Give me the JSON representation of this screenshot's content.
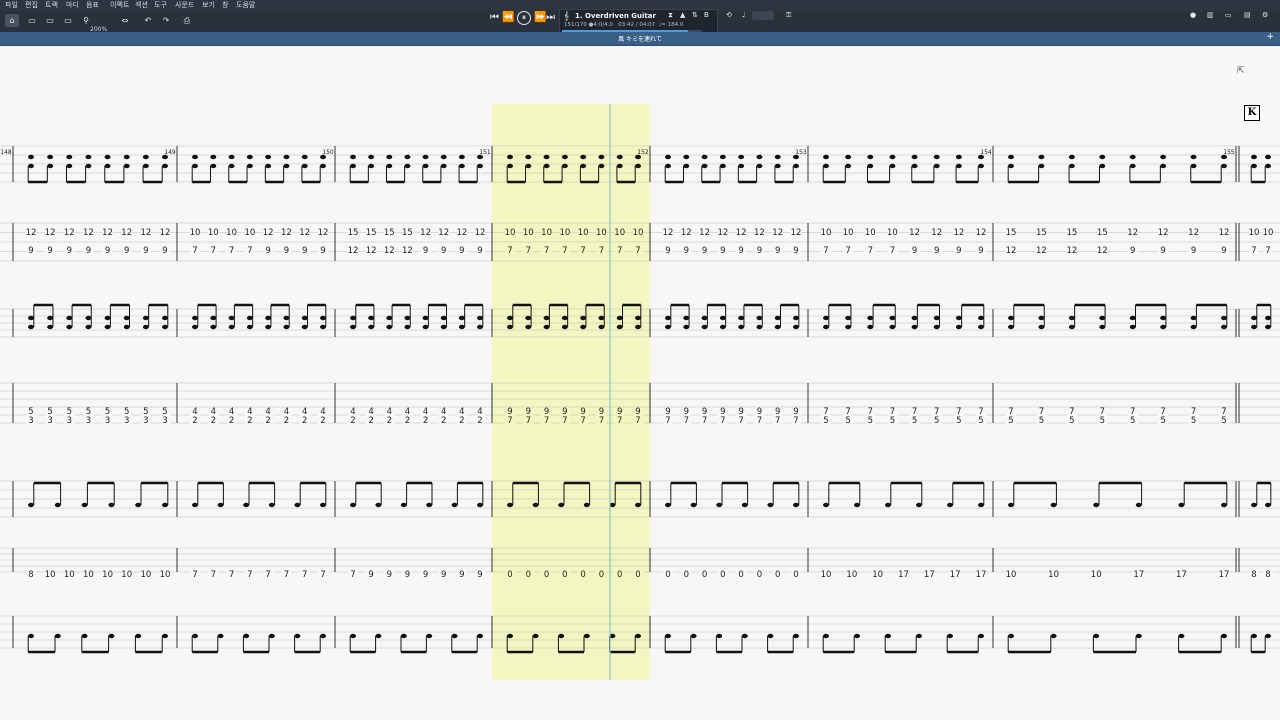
{
  "menu": [
    "파일",
    "편집",
    "트랙",
    "마디",
    "음표",
    "이펙트",
    "섹션",
    "도구",
    "사운드",
    "보기",
    "창",
    "도움말"
  ],
  "toolbar": {
    "zoom": "200%",
    "icons": [
      "home-icon",
      "page-view-icon",
      "screen-icon",
      "horizontal-view-icon",
      "zoom-icon",
      "fit-icon",
      "undo-icon",
      "redo-icon",
      "print-icon"
    ]
  },
  "transport": {
    "buttons": [
      "⏮",
      "⏪",
      "⏸",
      "⏩",
      "⏭"
    ]
  },
  "track": {
    "name": "1. Overdriven Guitar",
    "bar_position": "151/170",
    "time_signature": "4:0/4.0",
    "time": "03:42 / 04:07",
    "tempo": "♩= 184.0",
    "progress": 0.9
  },
  "subtitle": "風 キミを連れて",
  "badge": "K",
  "accent_colors": {
    "highlight": "#f3f6c0",
    "playhead": "#8ec3c0",
    "toolbar": "#2b313b",
    "subbar": "#3a5f86"
  },
  "measures": [
    "148",
    "149",
    "150",
    "151",
    "152",
    "153",
    "154",
    "155"
  ],
  "tab1": {
    "top": [
      [
        "12",
        "12",
        "12",
        "12",
        "12",
        "12",
        "12",
        "12"
      ],
      [
        "10",
        "10",
        "10",
        "10",
        "12",
        "12",
        "12",
        "12"
      ],
      [
        "15",
        "15",
        "15",
        "15",
        "12",
        "12",
        "12",
        "12"
      ],
      [
        "10",
        "10",
        "10",
        "10",
        "10",
        "10",
        "10",
        "10"
      ],
      [
        "12",
        "12",
        "12",
        "12",
        "12",
        "12",
        "12",
        "12"
      ],
      [
        "10",
        "10",
        "10",
        "10",
        "12",
        "12",
        "12",
        "12"
      ],
      [
        "15",
        "15",
        "15",
        "15",
        "12",
        "12",
        "12",
        "12"
      ],
      [
        "10",
        "10"
      ]
    ],
    "bottom": [
      [
        "9",
        "9",
        "9",
        "9",
        "9",
        "9",
        "9",
        "9"
      ],
      [
        "7",
        "7",
        "7",
        "7",
        "9",
        "9",
        "9",
        "9"
      ],
      [
        "12",
        "12",
        "12",
        "12",
        "9",
        "9",
        "9",
        "9"
      ],
      [
        "7",
        "7",
        "7",
        "7",
        "7",
        "7",
        "7",
        "7"
      ],
      [
        "9",
        "9",
        "9",
        "9",
        "9",
        "9",
        "9",
        "9"
      ],
      [
        "7",
        "7",
        "7",
        "7",
        "9",
        "9",
        "9",
        "9"
      ],
      [
        "12",
        "12",
        "12",
        "12",
        "9",
        "9",
        "9",
        "9"
      ],
      [
        "7",
        "7"
      ]
    ]
  },
  "tab2": {
    "top": [
      [
        "5",
        "5",
        "5",
        "5",
        "5",
        "5",
        "5",
        "5"
      ],
      [
        "4",
        "4",
        "4",
        "4",
        "4",
        "4",
        "4",
        "4"
      ],
      [
        "4",
        "4",
        "4",
        "4",
        "4",
        "4",
        "4",
        "4"
      ],
      [
        "9",
        "9",
        "9",
        "9",
        "9",
        "9",
        "9",
        "9"
      ],
      [
        "9",
        "9",
        "9",
        "9",
        "9",
        "9",
        "9",
        "9"
      ],
      [
        "7",
        "7",
        "7",
        "7",
        "7",
        "7",
        "7",
        "7"
      ],
      [
        "7",
        "7",
        "7",
        "7",
        "7",
        "7",
        "7",
        "7"
      ],
      []
    ],
    "bottom": [
      [
        "3",
        "3",
        "3",
        "3",
        "3",
        "3",
        "3",
        "3"
      ],
      [
        "2",
        "2",
        "2",
        "2",
        "2",
        "2",
        "2",
        "2"
      ],
      [
        "2",
        "2",
        "2",
        "2",
        "2",
        "2",
        "2",
        "2"
      ],
      [
        "7",
        "7",
        "7",
        "7",
        "7",
        "7",
        "7",
        "7"
      ],
      [
        "7",
        "7",
        "7",
        "7",
        "7",
        "7",
        "7",
        "7"
      ],
      [
        "5",
        "5",
        "5",
        "5",
        "5",
        "5",
        "5",
        "5"
      ],
      [
        "5",
        "5",
        "5",
        "5",
        "5",
        "5",
        "5",
        "5"
      ],
      []
    ]
  },
  "tab3": [
    [
      "8",
      "10",
      "10",
      "10",
      "10",
      "10",
      "10",
      "10"
    ],
    [
      "7",
      "7",
      "7",
      "7",
      "7",
      "7",
      "7",
      "7"
    ],
    [
      "7",
      "9",
      "9",
      "9",
      "9",
      "9",
      "9",
      "9"
    ],
    [
      "0",
      "0",
      "0",
      "0",
      "0",
      "0",
      "0",
      "0"
    ],
    [
      "0",
      "0",
      "0",
      "0",
      "0",
      "0",
      "0",
      "0"
    ],
    [
      "10",
      "10",
      "10",
      "17",
      "17",
      "17",
      "17"
    ],
    [
      "10",
      "10",
      "10",
      "17",
      "17",
      "17"
    ],
    [
      "8",
      "8"
    ]
  ]
}
